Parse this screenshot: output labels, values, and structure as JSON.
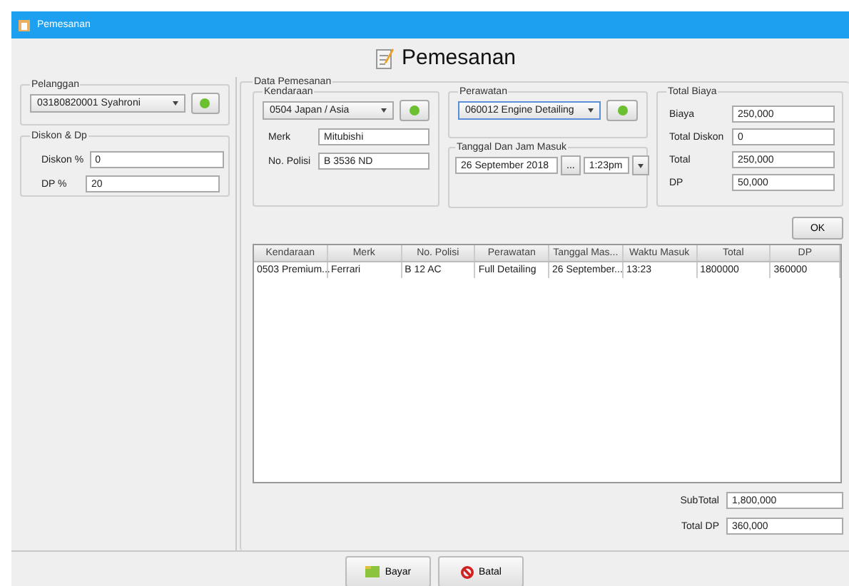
{
  "window": {
    "title": "Pemesanan"
  },
  "header": {
    "title": "Pemesanan"
  },
  "pelanggan": {
    "legend": "Pelanggan",
    "select": "03180820001 Syahroni"
  },
  "diskon_dp": {
    "legend": "Diskon & Dp",
    "fields": [
      {
        "label": "Diskon %",
        "value": "0"
      },
      {
        "label": "DP %",
        "value": "20"
      }
    ]
  },
  "data_pemesanan": {
    "legend": "Data Pemesanan",
    "kendaraan": {
      "legend": "Kendaraan",
      "select": "0504 Japan / Asia",
      "fields": [
        {
          "label": "Merk",
          "value": "Mitubishi"
        },
        {
          "label": "No. Polisi",
          "value": "B 3536 ND"
        }
      ]
    },
    "perawatan": {
      "legend": "Perawatan",
      "select": "060012 Engine Detailing",
      "focused": true
    },
    "tanggal": {
      "legend": "Tanggal Dan Jam Masuk",
      "date": "26 September 2018",
      "date_button": "...",
      "time": "1:23pm"
    },
    "total_biaya": {
      "legend": "Total Biaya",
      "fields": [
        {
          "label": "Biaya",
          "value": "250,000"
        },
        {
          "label": "Total Diskon",
          "value": "0"
        },
        {
          "label": "Total",
          "value": "250,000"
        },
        {
          "label": "DP",
          "value": "50,000"
        }
      ]
    },
    "ok_button": "OK"
  },
  "table": {
    "columns": [
      "Kendaraan",
      "Merk",
      "No. Polisi",
      "Perawatan",
      "Tanggal Mas...",
      "Waktu Masuk",
      "Total",
      "DP"
    ],
    "rows": [
      [
        "0503 Premium...",
        "Ferrari",
        "B 12 AC",
        "Full Detailing",
        "26 September...",
        "13:23",
        "1800000",
        "360000"
      ]
    ]
  },
  "summary": [
    {
      "label": "SubTotal",
      "value": "1,800,000"
    },
    {
      "label": "Total DP",
      "value": "360,000"
    }
  ],
  "buttons": [
    {
      "label": "Bayar",
      "kind": "pay"
    },
    {
      "label": "Batal",
      "kind": "cancel"
    }
  ]
}
